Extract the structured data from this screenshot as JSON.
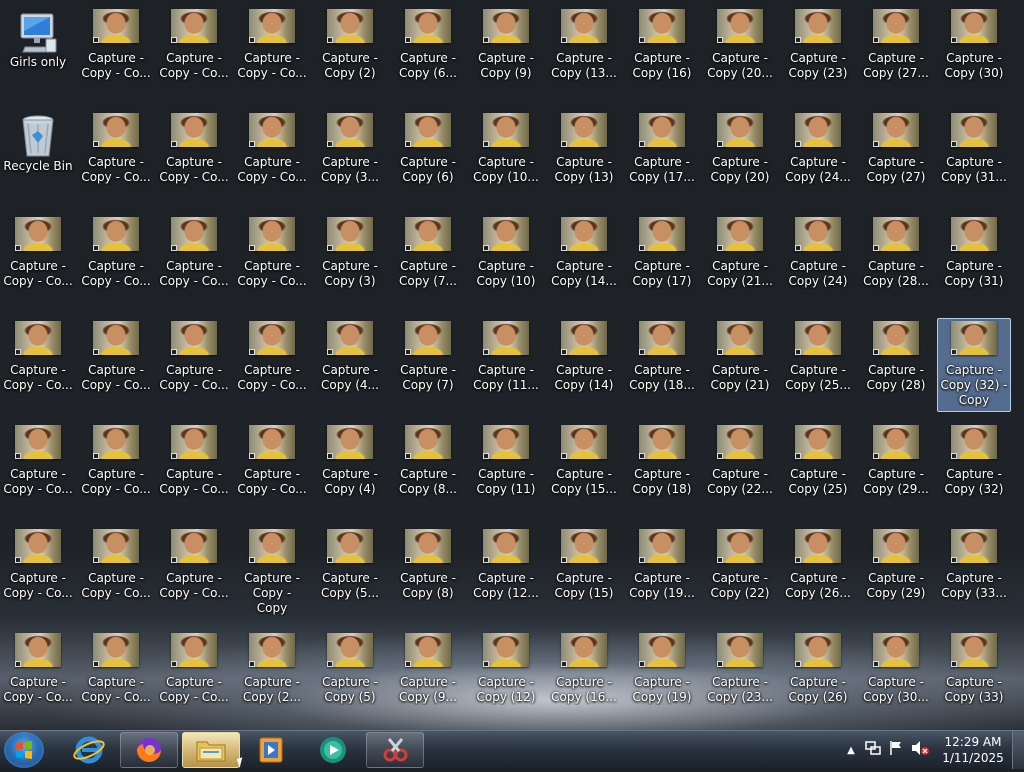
{
  "system_icons": [
    {
      "label": "Girls only",
      "icon": "computer-icon"
    },
    {
      "label": "Recycle Bin",
      "icon": "recycle-bin-icon"
    }
  ],
  "columns": [
    [
      "Capture -\nCopy - Co...",
      "Capture -\nCopy - Co...",
      "Capture -\nCopy - Co...",
      "Capture -\nCopy - Co...",
      "Capture -\nCopy - Co..."
    ],
    [
      "Capture -\nCopy - Co...",
      "Capture -\nCopy - Co...",
      "Capture -\nCopy - Co...",
      "Capture -\nCopy - Co...",
      "Capture -\nCopy - Co...",
      "Capture -\nCopy - Co...",
      "Capture -\nCopy - Co..."
    ],
    [
      "Capture -\nCopy - Co...",
      "Capture -\nCopy - Co...",
      "Capture -\nCopy - Co...",
      "Capture -\nCopy - Co...",
      "Capture -\nCopy - Co...",
      "Capture -\nCopy - Co...",
      "Capture -\nCopy - Co..."
    ],
    [
      "Capture -\nCopy - Co...",
      "Capture -\nCopy - Co...",
      "Capture -\nCopy - Co...",
      "Capture -\nCopy - Co...",
      "Capture -\nCopy - Co...",
      "Capture -\nCopy - Copy",
      "Capture -\nCopy (2..."
    ],
    [
      "Capture -\nCopy (2)",
      "Capture -\nCopy (3...",
      "Capture -\nCopy (3)",
      "Capture -\nCopy (4...",
      "Capture -\nCopy (4)",
      "Capture -\nCopy (5...",
      "Capture -\nCopy (5)"
    ],
    [
      "Capture -\nCopy (6...",
      "Capture -\nCopy (6)",
      "Capture -\nCopy (7...",
      "Capture -\nCopy (7)",
      "Capture -\nCopy (8...",
      "Capture -\nCopy (8)",
      "Capture -\nCopy (9..."
    ],
    [
      "Capture -\nCopy (9)",
      "Capture -\nCopy (10...",
      "Capture -\nCopy (10)",
      "Capture -\nCopy (11...",
      "Capture -\nCopy (11)",
      "Capture -\nCopy (12...",
      "Capture -\nCopy (12)"
    ],
    [
      "Capture -\nCopy (13...",
      "Capture -\nCopy (13)",
      "Capture -\nCopy (14...",
      "Capture -\nCopy (14)",
      "Capture -\nCopy (15...",
      "Capture -\nCopy (15)",
      "Capture -\nCopy (16..."
    ],
    [
      "Capture -\nCopy (16)",
      "Capture -\nCopy (17...",
      "Capture -\nCopy (17)",
      "Capture -\nCopy (18...",
      "Capture -\nCopy (18)",
      "Capture -\nCopy (19...",
      "Capture -\nCopy (19)"
    ],
    [
      "Capture -\nCopy (20...",
      "Capture -\nCopy (20)",
      "Capture -\nCopy (21...",
      "Capture -\nCopy (21)",
      "Capture -\nCopy (22...",
      "Capture -\nCopy (22)",
      "Capture -\nCopy (23..."
    ],
    [
      "Capture -\nCopy (23)",
      "Capture -\nCopy (24...",
      "Capture -\nCopy (24)",
      "Capture -\nCopy (25...",
      "Capture -\nCopy (25)",
      "Capture -\nCopy (26...",
      "Capture -\nCopy (26)"
    ],
    [
      "Capture -\nCopy (27...",
      "Capture -\nCopy (27)",
      "Capture -\nCopy (28...",
      "Capture -\nCopy (28)",
      "Capture -\nCopy (29...",
      "Capture -\nCopy (29)",
      "Capture -\nCopy (30..."
    ],
    [
      "Capture -\nCopy (30)",
      "Capture -\nCopy (31...",
      "Capture -\nCopy (31)",
      "Capture -\nCopy (32) -\nCopy",
      "Capture -\nCopy (32)",
      "Capture -\nCopy (33...",
      "Capture -\nCopy (33)"
    ]
  ],
  "selected_icon": "Capture -\nCopy (32) -\nCopy",
  "taskbar": {
    "start_icon": "windows-start-icon",
    "pinned": [
      {
        "name": "internet-explorer-icon"
      },
      {
        "name": "firefox-icon"
      },
      {
        "name": "file-explorer-icon",
        "active": true
      },
      {
        "name": "media-player-icon"
      },
      {
        "name": "media-center-icon"
      },
      {
        "name": "snipping-tool-icon"
      }
    ],
    "tray_icons": [
      "show-hidden-icons-arrow",
      "network-icon",
      "action-center-flag-icon",
      "volume-muted-icon"
    ],
    "time": "12:29 AM",
    "date": "1/11/2025"
  },
  "colors": {
    "selection": "#82aae1",
    "taskbar": "#2b3441"
  }
}
